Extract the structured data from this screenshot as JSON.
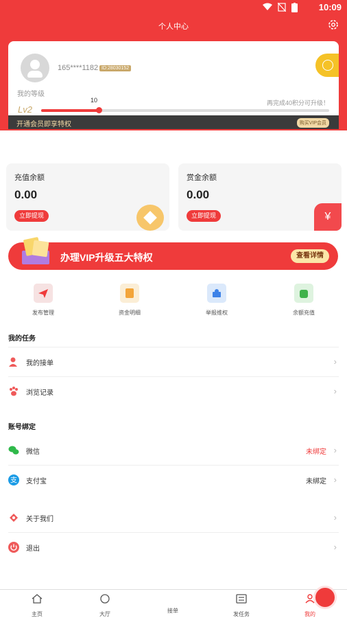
{
  "status_bar": {
    "time": "10:09"
  },
  "header": {
    "title": "个人中心"
  },
  "profile": {
    "phone": "165****1182",
    "uid": "ID:28030152",
    "level_label": "我的等级",
    "level": "Lv2",
    "points": "10",
    "points_progress": 0.2,
    "upgrade_tip": "再完成40积分可升级！",
    "vip_strip_text": "开通会员即享特权",
    "vip_strip_button": "购买VIP会员"
  },
  "balances": [
    {
      "label": "充值余额",
      "amount": "0.00",
      "button": "立即提现"
    },
    {
      "label": "赏金余额",
      "amount": "0.00",
      "button": "立即提现"
    }
  ],
  "banner": {
    "text": "办理VIP升级五大特权",
    "button": "查看详情"
  },
  "quick_actions": [
    {
      "label": "发布管理",
      "icon": "paper-plane-icon",
      "color": "#f6e2e2"
    },
    {
      "label": "资金明细",
      "icon": "ledger-icon",
      "color": "#fbeed6"
    },
    {
      "label": "举报维权",
      "icon": "alert-icon",
      "color": "#dbe9fb"
    },
    {
      "label": "余额充值",
      "icon": "wallet-icon",
      "color": "#def3df"
    }
  ],
  "tasks": {
    "title": "我的任务",
    "items": [
      {
        "label": "我的接单",
        "icon": "user-task-icon"
      },
      {
        "label": "浏览记录",
        "icon": "paw-icon"
      }
    ]
  },
  "accounts": {
    "title": "账号绑定",
    "items": [
      {
        "label": "微信",
        "value": "未绑定",
        "value_color": "#ef3b3b",
        "icon": "wechat-icon"
      },
      {
        "label": "支付宝",
        "value": "未绑定",
        "value_color": "#333333",
        "icon": "alipay-icon"
      }
    ]
  },
  "others": [
    {
      "label": "关于我们",
      "icon": "about-icon"
    },
    {
      "label": "退出",
      "icon": "power-icon"
    }
  ],
  "tabbar": [
    {
      "label": "主页",
      "icon": "home-icon"
    },
    {
      "label": "大厅",
      "icon": "hall-icon"
    },
    {
      "label": "接单",
      "icon": "fire-icon"
    },
    {
      "label": "发任务",
      "icon": "post-task-icon"
    },
    {
      "label": "我的",
      "icon": "profile-icon",
      "active": true
    }
  ],
  "colors": {
    "primary": "#ef3b3b",
    "gold": "#c9a86a",
    "vip_dark": "#3b3b3b"
  }
}
